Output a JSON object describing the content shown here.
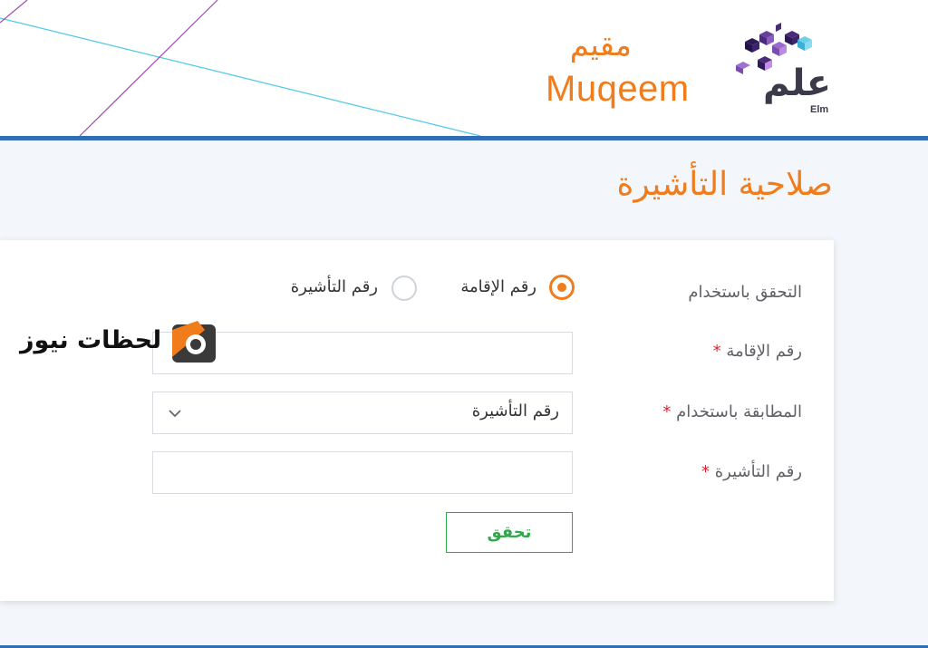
{
  "header": {
    "muqeem_logo_ar": "مقيم",
    "muqeem_logo_en": "Muqeem",
    "elm_logo_ar": "علم",
    "elm_logo_en": "Elm"
  },
  "page": {
    "title": "صلاحية التأشيرة"
  },
  "form": {
    "verify_by_label": "التحقق باستخدام",
    "options": [
      {
        "label": "رقم الإقامة",
        "selected": true
      },
      {
        "label": "رقم التأشيرة",
        "selected": false
      }
    ],
    "iqama_label": "رقم الإقامة",
    "iqama_value": "",
    "match_label": "المطابقة باستخدام",
    "match_selected": "رقم التأشيرة",
    "visa_label": "رقم التأشيرة",
    "visa_value": "",
    "required_mark": "*",
    "submit_label": "تحقق"
  },
  "watermark": {
    "text": "لحظات نيوز"
  },
  "colors": {
    "accent": "#f07c1c",
    "header_line": "#2f6db5",
    "button": "#2eaa4b",
    "required": "#e0202a"
  }
}
